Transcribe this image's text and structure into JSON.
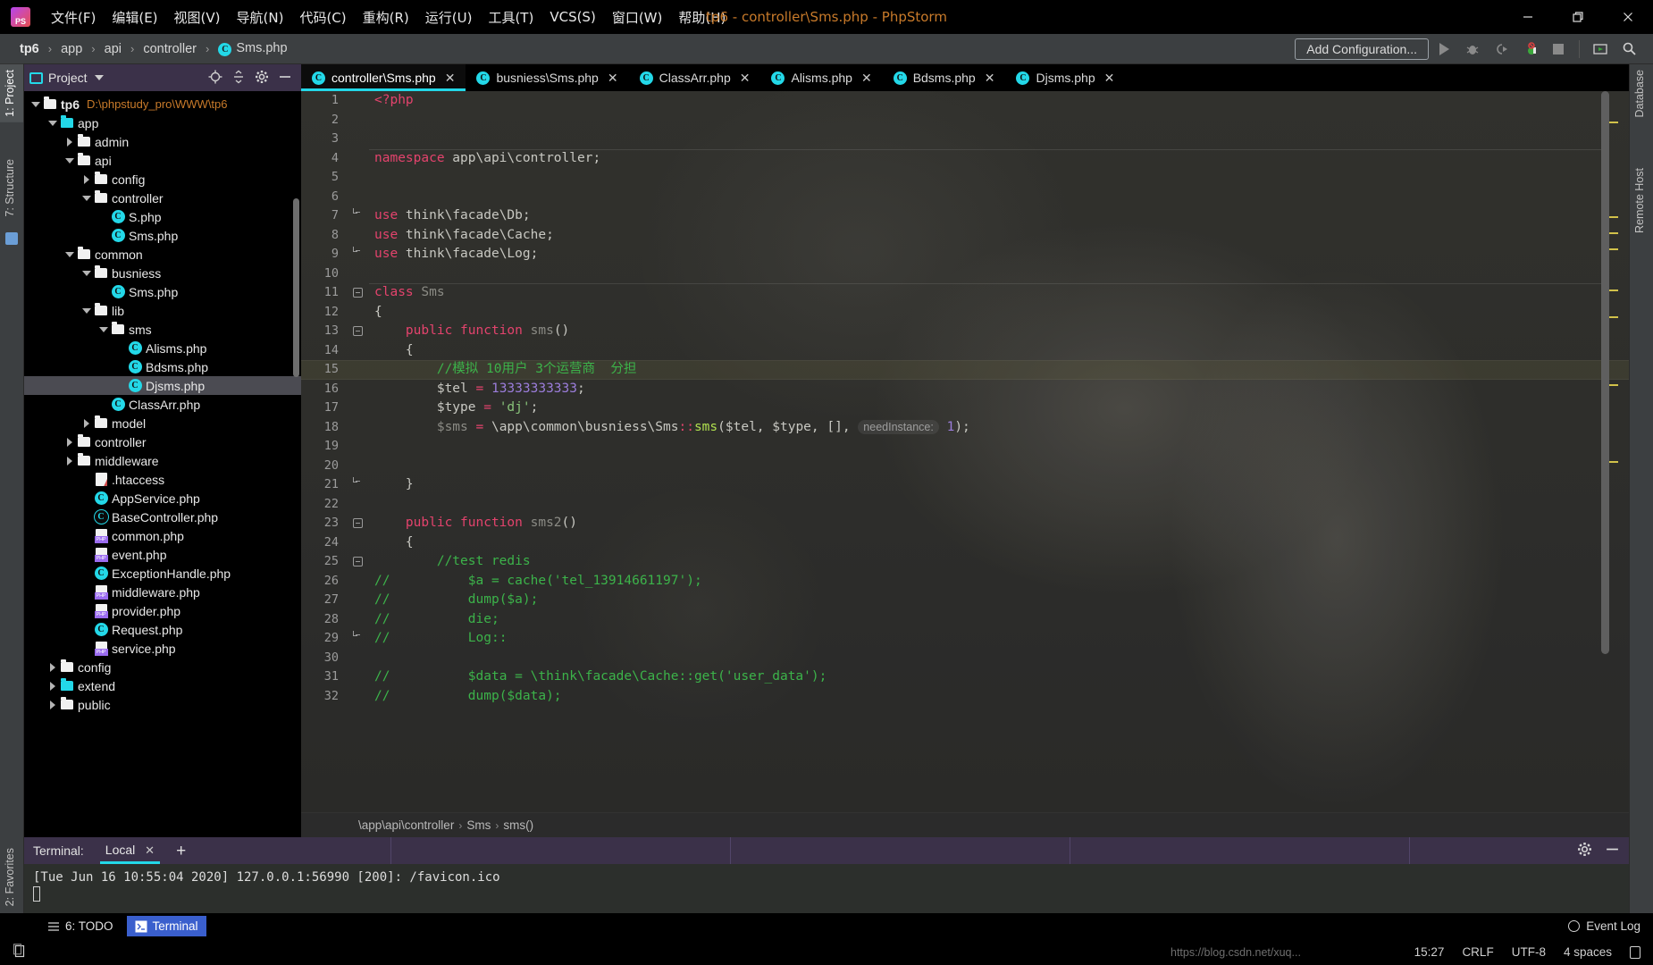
{
  "window": {
    "title": "tp6 - controller\\Sms.php - PhpStorm",
    "logo_text": "PS",
    "minimize": "—",
    "maximize": "❐",
    "close": "✕"
  },
  "menu": {
    "items": [
      {
        "label": "文件(F)",
        "name": "menu-file"
      },
      {
        "label": "编辑(E)",
        "name": "menu-edit"
      },
      {
        "label": "视图(V)",
        "name": "menu-view"
      },
      {
        "label": "导航(N)",
        "name": "menu-navigate"
      },
      {
        "label": "代码(C)",
        "name": "menu-code"
      },
      {
        "label": "重构(R)",
        "name": "menu-refactor"
      },
      {
        "label": "运行(U)",
        "name": "menu-run"
      },
      {
        "label": "工具(T)",
        "name": "menu-tools"
      },
      {
        "label": "VCS(S)",
        "name": "menu-vcs"
      },
      {
        "label": "窗口(W)",
        "name": "menu-window"
      },
      {
        "label": "帮助(H)",
        "name": "menu-help"
      }
    ]
  },
  "navbar": {
    "breadcrumbs": [
      "tp6",
      "app",
      "api",
      "controller",
      "Sms.php"
    ],
    "separator": "›",
    "add_configuration": "Add Configuration...",
    "icons": [
      "run-icon",
      "debug-icon",
      "run-coverage-icon",
      "profiler-icon",
      "stop-icon",
      "view-breakpoints-icon",
      "search-icon"
    ]
  },
  "left_strips": {
    "top": [
      {
        "label": "1: Project",
        "active": true,
        "name": "tool-window-project"
      },
      {
        "label": "7: Structure",
        "active": false,
        "name": "tool-window-structure"
      }
    ],
    "bottom": [
      {
        "label": "2: Favorites",
        "active": false,
        "name": "tool-window-favorites"
      }
    ]
  },
  "right_strips": {
    "items": [
      {
        "label": "Database",
        "name": "tool-window-database"
      },
      {
        "label": "Remote Host",
        "name": "tool-window-remote-host"
      }
    ]
  },
  "project": {
    "header_title": "Project",
    "header_icons": [
      "locate-icon",
      "collapse-all-icon",
      "settings-gear-icon",
      "hide-icon"
    ],
    "tree": [
      {
        "depth": 0,
        "arrow": "open",
        "icon": "folder",
        "label": "tp6",
        "bold": true,
        "path": "D:\\phpstudy_pro\\WWW\\tp6",
        "selected": false
      },
      {
        "depth": 1,
        "arrow": "open",
        "icon": "folder-cyan",
        "label": "app",
        "selected": false
      },
      {
        "depth": 2,
        "arrow": "closed",
        "icon": "folder",
        "label": "admin",
        "selected": false
      },
      {
        "depth": 2,
        "arrow": "open",
        "icon": "folder",
        "label": "api",
        "selected": false
      },
      {
        "depth": 3,
        "arrow": "closed",
        "icon": "folder",
        "label": "config",
        "selected": false
      },
      {
        "depth": 3,
        "arrow": "open",
        "icon": "folder",
        "label": "controller",
        "selected": false
      },
      {
        "depth": 4,
        "arrow": "none",
        "icon": "class",
        "label": "S.php",
        "selected": false
      },
      {
        "depth": 4,
        "arrow": "none",
        "icon": "class",
        "label": "Sms.php",
        "selected": false
      },
      {
        "depth": 2,
        "arrow": "open",
        "icon": "folder",
        "label": "common",
        "selected": false
      },
      {
        "depth": 3,
        "arrow": "open",
        "icon": "folder",
        "label": "busniess",
        "selected": false
      },
      {
        "depth": 4,
        "arrow": "none",
        "icon": "class",
        "label": "Sms.php",
        "selected": false
      },
      {
        "depth": 3,
        "arrow": "open",
        "icon": "folder",
        "label": "lib",
        "selected": false
      },
      {
        "depth": 4,
        "arrow": "open",
        "icon": "folder",
        "label": "sms",
        "selected": false
      },
      {
        "depth": 5,
        "arrow": "none",
        "icon": "class",
        "label": "Alisms.php",
        "selected": false
      },
      {
        "depth": 5,
        "arrow": "none",
        "icon": "class",
        "label": "Bdsms.php",
        "selected": false
      },
      {
        "depth": 5,
        "arrow": "none",
        "icon": "class",
        "label": "Djsms.php",
        "selected": true
      },
      {
        "depth": 4,
        "arrow": "none",
        "icon": "class",
        "label": "ClassArr.php",
        "selected": false
      },
      {
        "depth": 3,
        "arrow": "closed",
        "icon": "folder",
        "label": "model",
        "selected": false
      },
      {
        "depth": 2,
        "arrow": "closed",
        "icon": "folder",
        "label": "controller",
        "selected": false
      },
      {
        "depth": 2,
        "arrow": "closed",
        "icon": "folder",
        "label": "middleware",
        "selected": false
      },
      {
        "depth": 3,
        "arrow": "none",
        "icon": "htaccess",
        "label": ".htaccess",
        "selected": false
      },
      {
        "depth": 3,
        "arrow": "none",
        "icon": "class",
        "label": "AppService.php",
        "selected": false
      },
      {
        "depth": 3,
        "arrow": "none",
        "icon": "class-abstract",
        "label": "BaseController.php",
        "selected": false
      },
      {
        "depth": 3,
        "arrow": "none",
        "icon": "php",
        "label": "common.php",
        "selected": false
      },
      {
        "depth": 3,
        "arrow": "none",
        "icon": "php",
        "label": "event.php",
        "selected": false
      },
      {
        "depth": 3,
        "arrow": "none",
        "icon": "class",
        "label": "ExceptionHandle.php",
        "selected": false
      },
      {
        "depth": 3,
        "arrow": "none",
        "icon": "php",
        "label": "middleware.php",
        "selected": false
      },
      {
        "depth": 3,
        "arrow": "none",
        "icon": "php",
        "label": "provider.php",
        "selected": false
      },
      {
        "depth": 3,
        "arrow": "none",
        "icon": "class",
        "label": "Request.php",
        "selected": false
      },
      {
        "depth": 3,
        "arrow": "none",
        "icon": "php",
        "label": "service.php",
        "selected": false
      },
      {
        "depth": 1,
        "arrow": "closed",
        "icon": "folder",
        "label": "config",
        "selected": false
      },
      {
        "depth": 1,
        "arrow": "closed",
        "icon": "folder-cyan",
        "label": "extend",
        "selected": false
      },
      {
        "depth": 1,
        "arrow": "closed",
        "icon": "folder",
        "label": "public",
        "selected": false
      }
    ]
  },
  "editor": {
    "tabs": [
      {
        "label": "controller\\Sms.php",
        "active": true,
        "name": "tab-controller-sms"
      },
      {
        "label": "busniess\\Sms.php",
        "active": false,
        "name": "tab-busniess-sms"
      },
      {
        "label": "ClassArr.php",
        "active": false,
        "name": "tab-classarr"
      },
      {
        "label": "Alisms.php",
        "active": false,
        "name": "tab-alisms"
      },
      {
        "label": "Bdsms.php",
        "active": false,
        "name": "tab-bdsms"
      },
      {
        "label": "Djsms.php",
        "active": false,
        "name": "tab-djsms"
      }
    ],
    "close_glyph": "✕",
    "current_line": 15,
    "lines": [
      {
        "n": 1,
        "fold": "none",
        "tokens": [
          {
            "t": "<?php",
            "c": "kw"
          }
        ]
      },
      {
        "n": 2,
        "fold": "none",
        "tokens": []
      },
      {
        "n": 3,
        "fold": "none",
        "tokens": []
      },
      {
        "n": 4,
        "fold": "none",
        "sep": true,
        "tokens": [
          {
            "t": "namespace",
            "c": "kw"
          },
          {
            "t": " app\\api\\controller;",
            "c": "id"
          }
        ]
      },
      {
        "n": 5,
        "fold": "none",
        "tokens": []
      },
      {
        "n": 6,
        "fold": "none",
        "tokens": []
      },
      {
        "n": 7,
        "fold": "closing",
        "tokens": [
          {
            "t": "use",
            "c": "kw"
          },
          {
            "t": " think\\facade\\Db;",
            "c": "id"
          }
        ]
      },
      {
        "n": 8,
        "fold": "none",
        "tokens": [
          {
            "t": "use",
            "c": "kw"
          },
          {
            "t": " think\\facade\\Cache;",
            "c": "id"
          }
        ]
      },
      {
        "n": 9,
        "fold": "closing",
        "tokens": [
          {
            "t": "use",
            "c": "kw"
          },
          {
            "t": " think\\facade\\Log;",
            "c": "id"
          }
        ]
      },
      {
        "n": 10,
        "fold": "none",
        "tokens": []
      },
      {
        "n": 11,
        "fold": "box",
        "sep": true,
        "tokens": [
          {
            "t": "class",
            "c": "kw"
          },
          {
            "t": " Sms",
            "c": "dim"
          }
        ]
      },
      {
        "n": 12,
        "fold": "none",
        "tokens": [
          {
            "t": "{",
            "c": "id"
          }
        ]
      },
      {
        "n": 13,
        "fold": "box",
        "tokens": [
          {
            "t": "    ",
            "c": "id"
          },
          {
            "t": "public function",
            "c": "kw"
          },
          {
            "t": " ",
            "c": "id"
          },
          {
            "t": "sms",
            "c": "dim"
          },
          {
            "t": "()",
            "c": "id"
          }
        ]
      },
      {
        "n": 14,
        "fold": "none",
        "tokens": [
          {
            "t": "    {",
            "c": "id"
          }
        ]
      },
      {
        "n": 15,
        "fold": "none",
        "current": true,
        "tokens": [
          {
            "t": "        //模拟 10用户 3个运营商  分担",
            "c": "cmt"
          }
        ]
      },
      {
        "n": 16,
        "fold": "none",
        "tokens": [
          {
            "t": "        $tel ",
            "c": "var"
          },
          {
            "t": "=",
            "c": "kw"
          },
          {
            "t": " ",
            "c": "id"
          },
          {
            "t": "13333333333",
            "c": "num"
          },
          {
            "t": ";",
            "c": "id"
          }
        ]
      },
      {
        "n": 17,
        "fold": "none",
        "tokens": [
          {
            "t": "        $type ",
            "c": "var"
          },
          {
            "t": "=",
            "c": "kw"
          },
          {
            "t": " ",
            "c": "id"
          },
          {
            "t": "'dj'",
            "c": "str"
          },
          {
            "t": ";",
            "c": "id"
          }
        ]
      },
      {
        "n": 18,
        "fold": "none",
        "tokens": [
          {
            "t": "        ",
            "c": "id"
          },
          {
            "t": "$sms ",
            "c": "dim"
          },
          {
            "t": "=",
            "c": "kw"
          },
          {
            "t": " \\app\\common\\busniess\\Sms",
            "c": "id"
          },
          {
            "t": "::",
            "c": "kw"
          },
          {
            "t": "sms",
            "c": "fn"
          },
          {
            "t": "($tel, $type, [], ",
            "c": "id"
          }
        ],
        "hint": "needInstance:",
        "after_hint": [
          {
            "t": "1",
            "c": "num"
          },
          {
            "t": ");",
            "c": "id"
          }
        ]
      },
      {
        "n": 19,
        "fold": "none",
        "tokens": []
      },
      {
        "n": 20,
        "fold": "none",
        "tokens": []
      },
      {
        "n": 21,
        "fold": "closing",
        "tokens": [
          {
            "t": "    }",
            "c": "id"
          }
        ]
      },
      {
        "n": 22,
        "fold": "none",
        "tokens": []
      },
      {
        "n": 23,
        "fold": "box",
        "tokens": [
          {
            "t": "    ",
            "c": "id"
          },
          {
            "t": "public function",
            "c": "kw"
          },
          {
            "t": " ",
            "c": "id"
          },
          {
            "t": "sms2",
            "c": "dim"
          },
          {
            "t": "()",
            "c": "id"
          }
        ]
      },
      {
        "n": 24,
        "fold": "none",
        "tokens": [
          {
            "t": "    {",
            "c": "id"
          }
        ]
      },
      {
        "n": 25,
        "fold": "box",
        "tokens": [
          {
            "t": "        //test redis",
            "c": "cmt"
          }
        ]
      },
      {
        "n": 26,
        "fold": "none",
        "prefix": "//",
        "tokens": [
          {
            "t": "        $a = cache('tel_13914661197');",
            "c": "cmt"
          }
        ]
      },
      {
        "n": 27,
        "fold": "none",
        "prefix": "//",
        "tokens": [
          {
            "t": "        dump($a);",
            "c": "cmt"
          }
        ]
      },
      {
        "n": 28,
        "fold": "none",
        "prefix": "//",
        "tokens": [
          {
            "t": "        die;",
            "c": "cmt"
          }
        ]
      },
      {
        "n": 29,
        "fold": "closing",
        "prefix": "//",
        "tokens": [
          {
            "t": "        Log::",
            "c": "cmt"
          }
        ]
      },
      {
        "n": 30,
        "fold": "none",
        "tokens": []
      },
      {
        "n": 31,
        "fold": "none",
        "prefix": "//",
        "tokens": [
          {
            "t": "        $data = \\think\\facade\\Cache::get('user_data');",
            "c": "cmt"
          }
        ]
      },
      {
        "n": 32,
        "fold": "none",
        "prefix": "//",
        "tokens": [
          {
            "t": "        dump($data);",
            "c": "cmt"
          }
        ]
      }
    ],
    "status_breadcrumb": [
      "\\app\\api\\controller",
      "Sms",
      "sms()"
    ],
    "status_breadcrumb_sep": "›"
  },
  "terminal": {
    "label": "Terminal:",
    "tab": "Local",
    "close_glyph": "✕",
    "add_glyph": "+",
    "settings_icon": "gear-icon",
    "hide_icon": "hide-icon",
    "output": "[Tue Jun 16 10:55:04 2020] 127.0.0.1:56990 [200]: /favicon.ico"
  },
  "bottom_bar": {
    "items": [
      {
        "label": "6: TODO",
        "icon": "todo-icon",
        "active": false,
        "name": "bottom-tab-todo"
      },
      {
        "label": "Terminal",
        "icon": "terminal-icon",
        "active": true,
        "name": "bottom-tab-terminal"
      }
    ],
    "event_log": "Event Log"
  },
  "status_bar": {
    "time": "15:27",
    "line_sep": "CRLF",
    "encoding": "UTF-8",
    "indent": "4 spaces",
    "watermark": "https://blog.csdn.net/xuq...",
    "lock_icon": "lock-icon"
  }
}
